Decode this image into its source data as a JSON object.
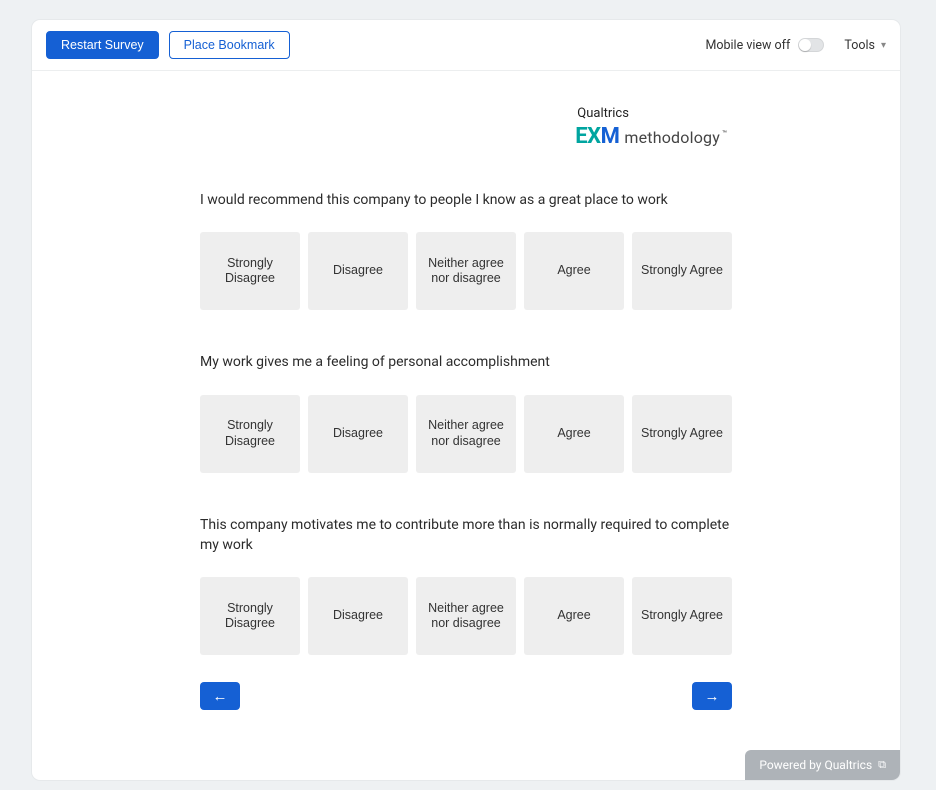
{
  "toolbar": {
    "restart_label": "Restart Survey",
    "bookmark_label": "Place Bookmark",
    "mobile_label": "Mobile view off",
    "tools_label": "Tools"
  },
  "logo": {
    "top": "Qualtrics",
    "ex": "EX",
    "m": "M",
    "method": "methodology",
    "tm": "™"
  },
  "scale": {
    "o1": "Strongly Disagree",
    "o2": "Disagree",
    "o3": "Neither agree nor disagree",
    "o4": "Agree",
    "o5": "Strongly Agree"
  },
  "questions": {
    "q1": "I would recommend this company to people I know as a great place to work",
    "q2": "My work gives me a feeling of personal accomplishment",
    "q3": "This company motivates me to contribute more than is normally required to complete my work"
  },
  "nav": {
    "prev": "←",
    "next": "→"
  },
  "footer": {
    "powered": "Powered by Qualtrics",
    "ext": "⧉"
  }
}
